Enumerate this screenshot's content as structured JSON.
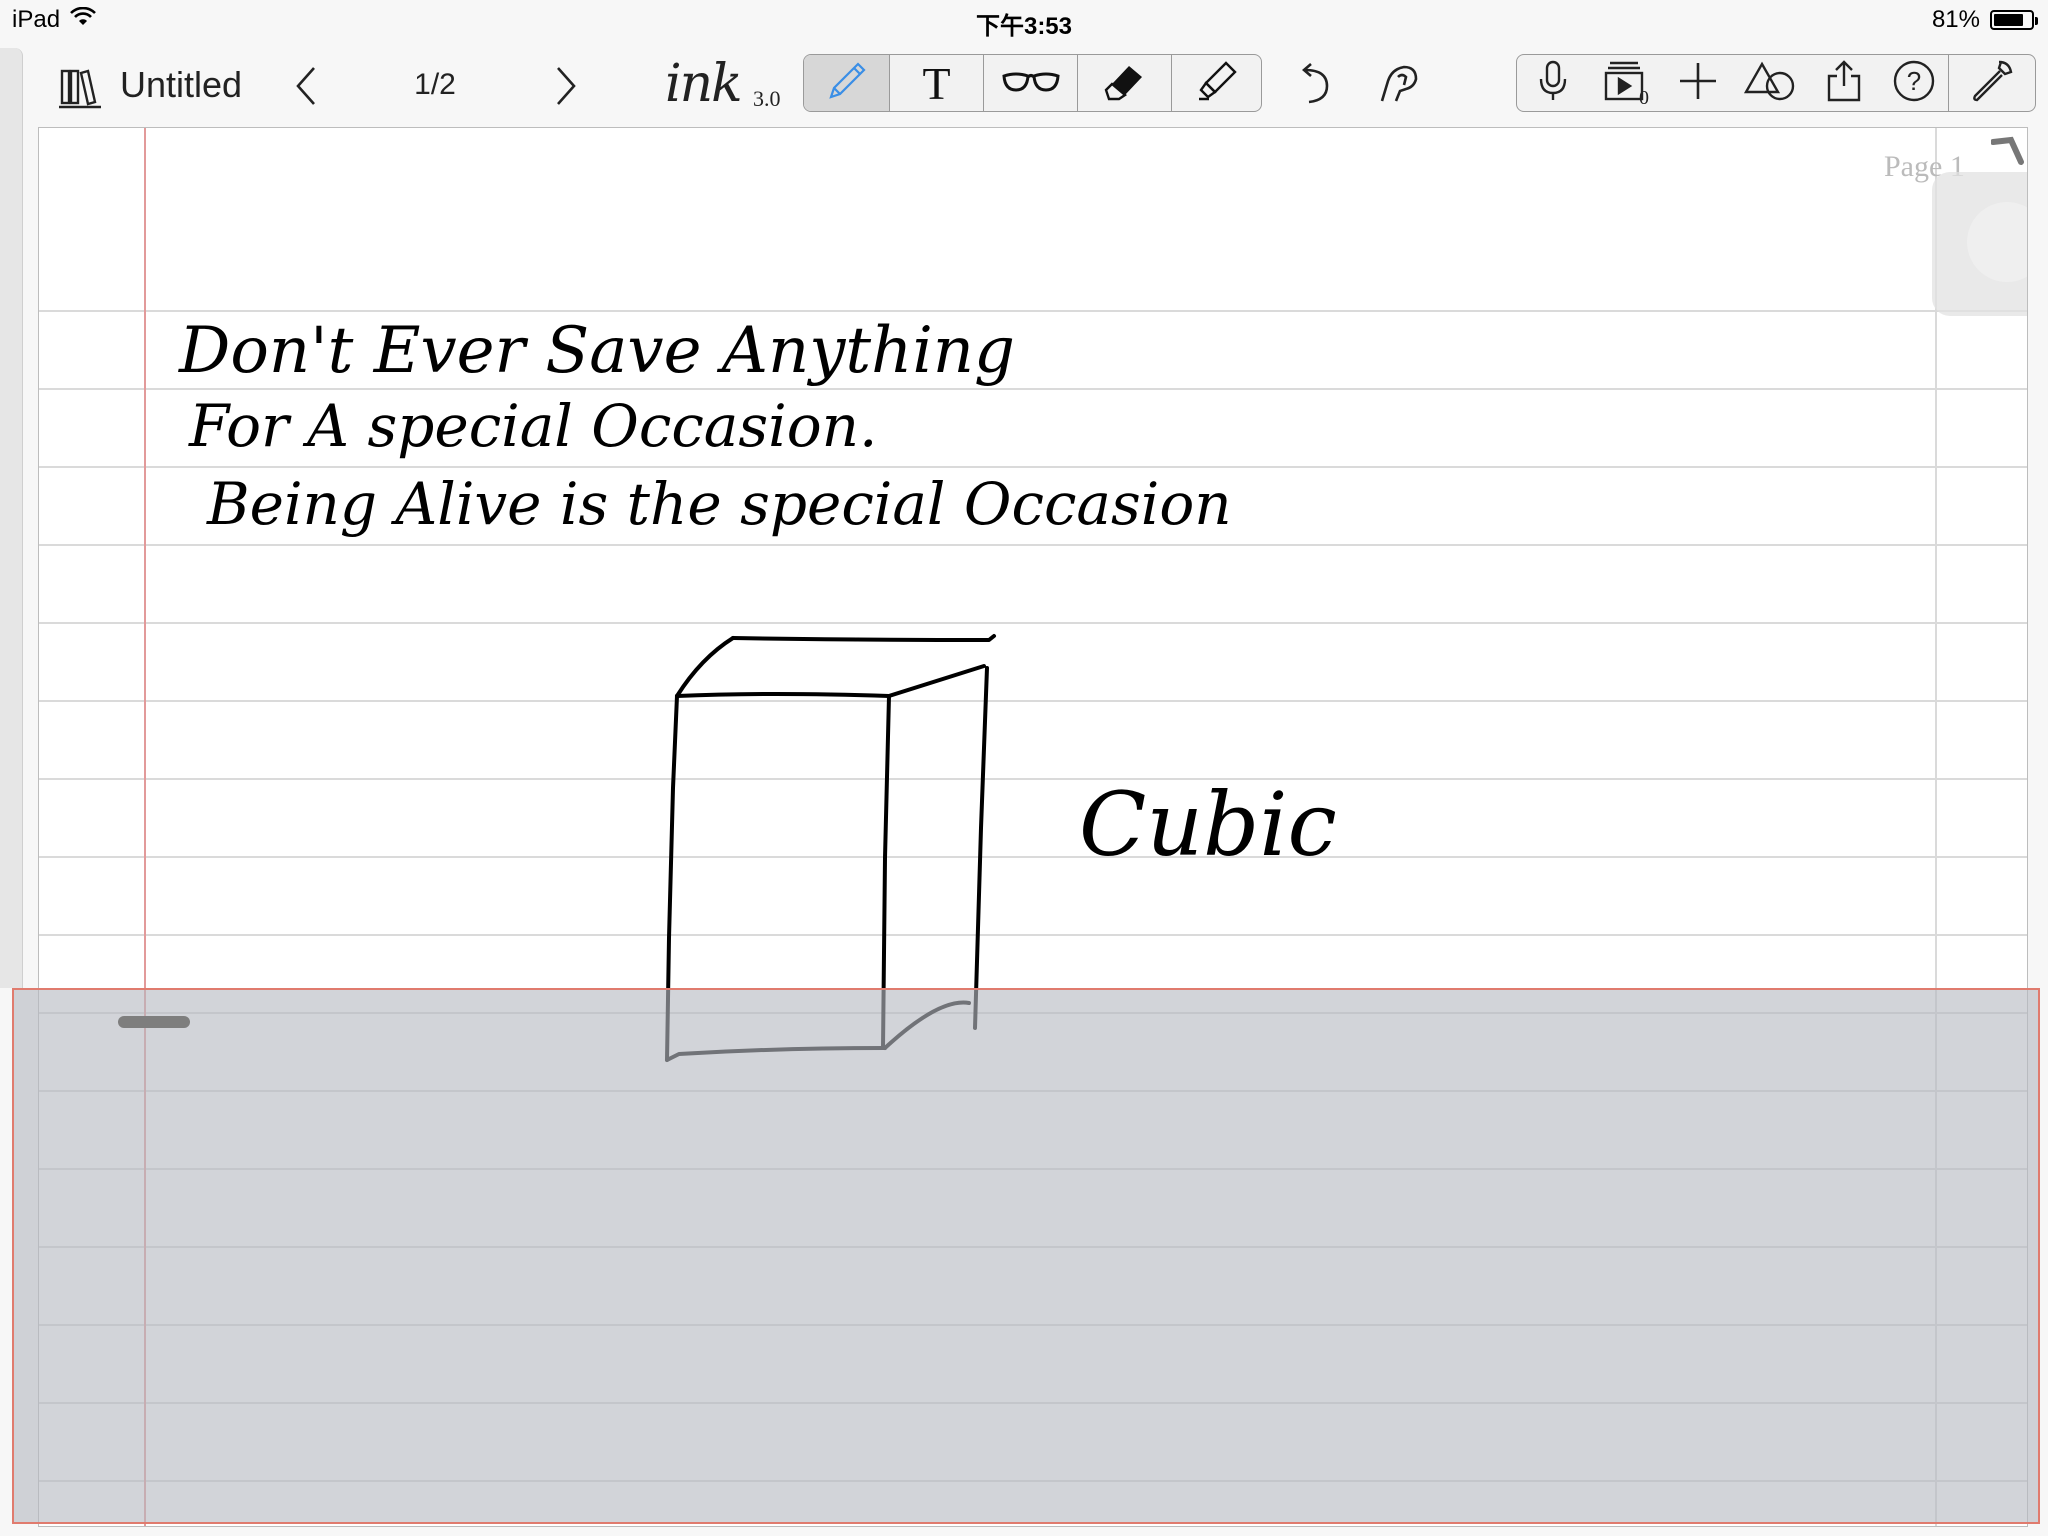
{
  "status_bar": {
    "device": "iPad",
    "time": "下午3:53",
    "battery": "81%",
    "battery_level": 0.81
  },
  "toolbar": {
    "library_icon": "books-icon",
    "title": "Untitled",
    "page_indicator": "1/2",
    "logo": "ink",
    "logo_version": "3.0",
    "tools": [
      "pen-icon",
      "text-icon",
      "glasses-icon",
      "eraser-icon",
      "highlighter-icon"
    ],
    "active_tool": "pen",
    "right_tools": [
      "microphone-icon",
      "slideshow-icon",
      "plus-icon",
      "shapes-icon",
      "share-icon",
      "help-icon",
      "wrench-icon"
    ],
    "slideshow_count": "0"
  },
  "page": {
    "label": "Page 1",
    "handwriting": [
      "Don't Ever Save Anything",
      "For A special Occasion.",
      "Being Alive is the special Occasion",
      "Cubic"
    ]
  },
  "colors": {
    "accent": "#3a8ee6",
    "margin_line": "#e29a9a",
    "panel_border": "#e07b6e"
  }
}
